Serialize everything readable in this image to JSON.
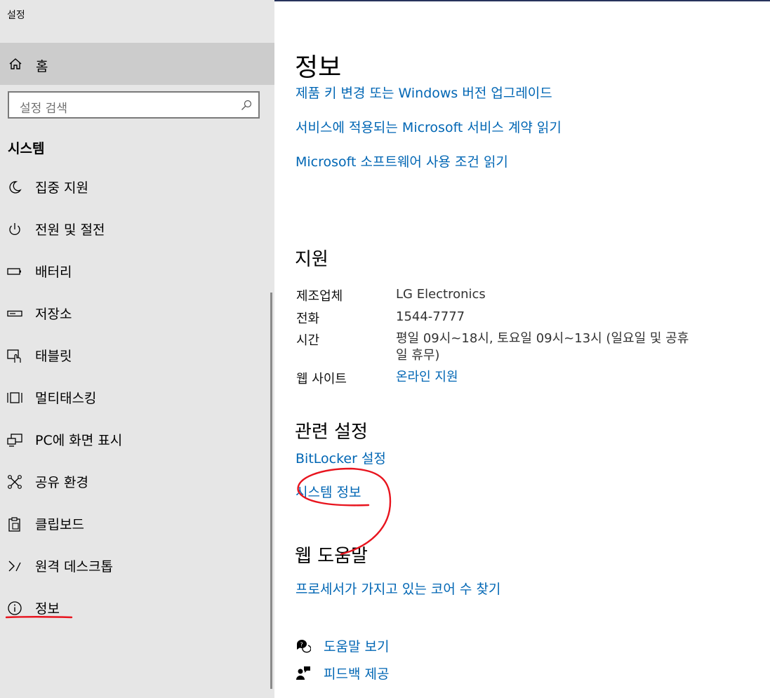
{
  "window": {
    "title": "설정"
  },
  "sidebar": {
    "home_label": "홈",
    "search_placeholder": "설정 검색",
    "section_title": "시스템",
    "items": [
      {
        "label": "집중 지원",
        "icon": "moon-icon"
      },
      {
        "label": "전원 및 절전",
        "icon": "power-icon"
      },
      {
        "label": "배터리",
        "icon": "battery-icon"
      },
      {
        "label": "저장소",
        "icon": "storage-icon"
      },
      {
        "label": "태블릿",
        "icon": "tablet-icon"
      },
      {
        "label": "멀티태스킹",
        "icon": "multitasking-icon"
      },
      {
        "label": "PC에 화면 표시",
        "icon": "project-icon"
      },
      {
        "label": "공유 환경",
        "icon": "share-icon"
      },
      {
        "label": "클립보드",
        "icon": "clipboard-icon"
      },
      {
        "label": "원격 데스크톱",
        "icon": "remote-desktop-icon"
      },
      {
        "label": "정보",
        "icon": "info-icon",
        "selected": true
      }
    ]
  },
  "main": {
    "title": "정보",
    "links": [
      "제품 키 변경 또는 Windows 버전 업그레이드",
      "서비스에 적용되는 Microsoft 서비스 계약 읽기",
      "Microsoft 소프트웨어 사용 조건 읽기"
    ],
    "support": {
      "title": "지원",
      "rows": [
        {
          "key": "제조업체",
          "value": "LG Electronics"
        },
        {
          "key": "전화",
          "value": "1544-7777"
        },
        {
          "key": "시간",
          "value": "평일 09시~18시, 토요일 09시~13시 (일요일 및 공휴일 휴무)"
        },
        {
          "key": "웹 사이트",
          "value": "온라인 지원"
        }
      ]
    },
    "related": {
      "title": "관련 설정",
      "links": [
        "BitLocker 설정",
        "시스템 정보"
      ]
    },
    "web_help": {
      "title": "웹 도움말",
      "link": "프로세서가 가지고 있는 코어 수 찾기"
    },
    "footer": [
      {
        "label": "도움말 보기",
        "icon": "help-chat-icon"
      },
      {
        "label": "피드백 제공",
        "icon": "feedback-icon"
      }
    ]
  },
  "colors": {
    "link": "#0066b4",
    "sidebar_bg": "#e6e6e6",
    "home_bg": "#cccccc",
    "annotation": "#e8141e"
  }
}
